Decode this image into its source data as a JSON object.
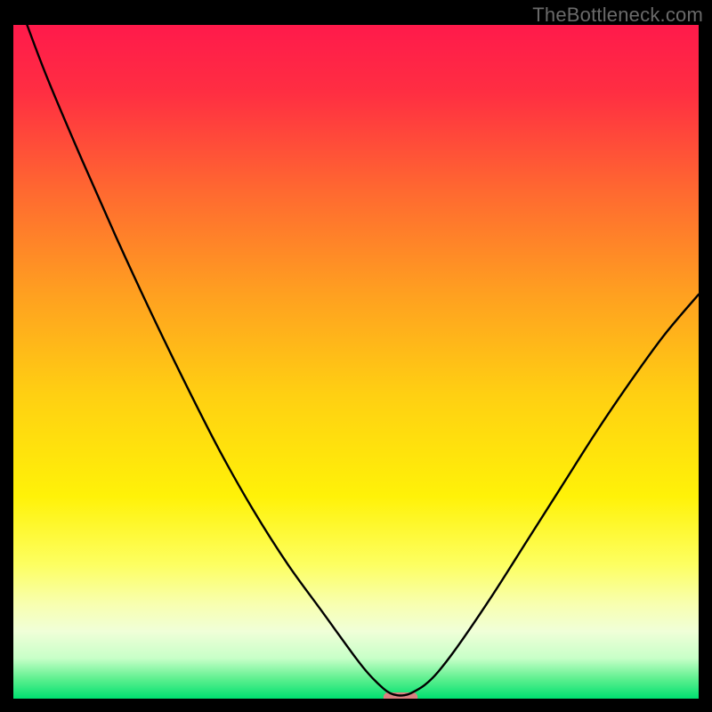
{
  "watermark": "TheBottleneck.com",
  "chart_data": {
    "type": "line",
    "title": "",
    "xlabel": "",
    "ylabel": "",
    "xlim": [
      0,
      100
    ],
    "ylim": [
      0,
      100
    ],
    "series": [
      {
        "name": "bottleneck-curve",
        "x": [
          2,
          5,
          10,
          15,
          20,
          25,
          30,
          35,
          40,
          45,
          50,
          52,
          54,
          55,
          56,
          57,
          58,
          60,
          62,
          65,
          70,
          75,
          80,
          85,
          90,
          95,
          100
        ],
        "values": [
          100,
          92,
          80,
          68.5,
          57.5,
          47,
          37,
          28,
          20,
          13,
          6,
          3.5,
          1.5,
          0.8,
          0.5,
          0.5,
          0.8,
          2,
          4,
          8,
          15.5,
          23.5,
          31.5,
          39.5,
          47,
          54,
          60
        ]
      }
    ],
    "optimal_marker": {
      "x_start": 54,
      "x_end": 59,
      "y": 0
    },
    "gradient_stops": [
      {
        "offset": 0.0,
        "color": "#ff1a4b"
      },
      {
        "offset": 0.1,
        "color": "#ff2e42"
      },
      {
        "offset": 0.25,
        "color": "#ff6a30"
      },
      {
        "offset": 0.4,
        "color": "#ffa020"
      },
      {
        "offset": 0.55,
        "color": "#ffd012"
      },
      {
        "offset": 0.7,
        "color": "#fff208"
      },
      {
        "offset": 0.8,
        "color": "#fdff60"
      },
      {
        "offset": 0.86,
        "color": "#f8ffb0"
      },
      {
        "offset": 0.9,
        "color": "#f0ffd8"
      },
      {
        "offset": 0.94,
        "color": "#c8ffc8"
      },
      {
        "offset": 0.97,
        "color": "#60f090"
      },
      {
        "offset": 1.0,
        "color": "#00e070"
      }
    ],
    "optimal_marker_color": "#d98080"
  }
}
